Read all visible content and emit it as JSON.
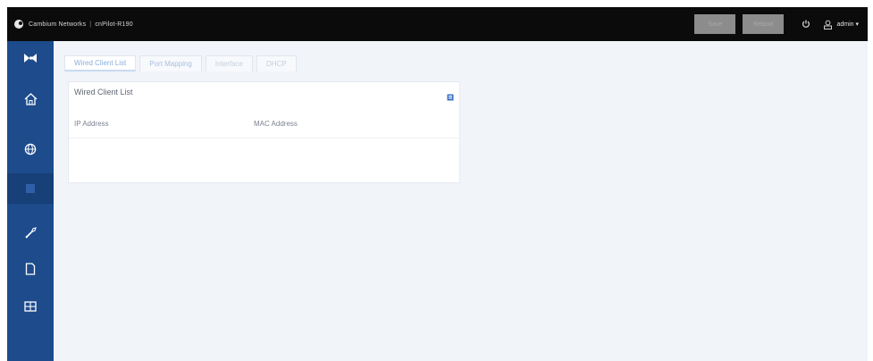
{
  "topbar": {
    "brand": "Cambium Networks",
    "separator": "|",
    "device": "cnPilot-R190",
    "buttons": [
      "Save",
      "Reboot"
    ],
    "user": "admin ▾"
  },
  "sidebar": {
    "items": [
      "collapse-icon",
      "home-icon",
      "network-icon",
      "clients-icon",
      "tools-icon",
      "document-icon",
      "grid-icon"
    ],
    "active": "clients-icon"
  },
  "tabs": {
    "items": [
      "Wired Client List",
      "Port Mapping",
      "Interface",
      "DHCP"
    ],
    "active": "Wired Client List"
  },
  "panel": {
    "title": "Wired Client List",
    "columns": [
      "IP Address",
      "MAC Address"
    ]
  },
  "colors": {
    "topbar": "#0b0b0b",
    "sidebar": "#1d4b8c",
    "content_bg": "#f1f4f9",
    "accent": "#3b6fc0"
  }
}
